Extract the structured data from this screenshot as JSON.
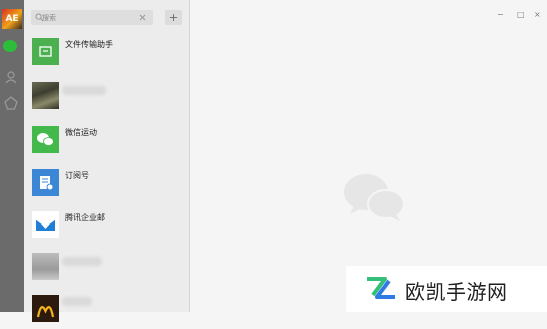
{
  "app": {
    "rail_avatar_text": "AE",
    "search_placeholder": "搜索",
    "add_label": "+",
    "window_controls": [
      "−",
      "□",
      "×"
    ]
  },
  "conversations": [
    {
      "label": "文件传输助手",
      "icon": "folder-icon",
      "color": "#4caf50"
    },
    {
      "label": "",
      "icon": "photo-avatar",
      "color": "#555555"
    },
    {
      "label": "微信运动",
      "icon": "wechat-run-icon",
      "color": "#42b94a"
    },
    {
      "label": "订阅号",
      "icon": "subscription-icon",
      "color": "#3b87d6"
    },
    {
      "label": "腾讯企业邮",
      "icon": "tencent-mail-icon",
      "color": "#1f7fd6"
    },
    {
      "label": "",
      "icon": "photo-avatar",
      "color": "#9a9a9a"
    },
    {
      "label": "",
      "icon": "mcdonalds-avatar",
      "color": "#2d1a0f"
    }
  ],
  "watermark": {
    "text": "欧凯手游网",
    "colors": {
      "green": "#35c07a",
      "blue": "#2f7ae5"
    }
  }
}
